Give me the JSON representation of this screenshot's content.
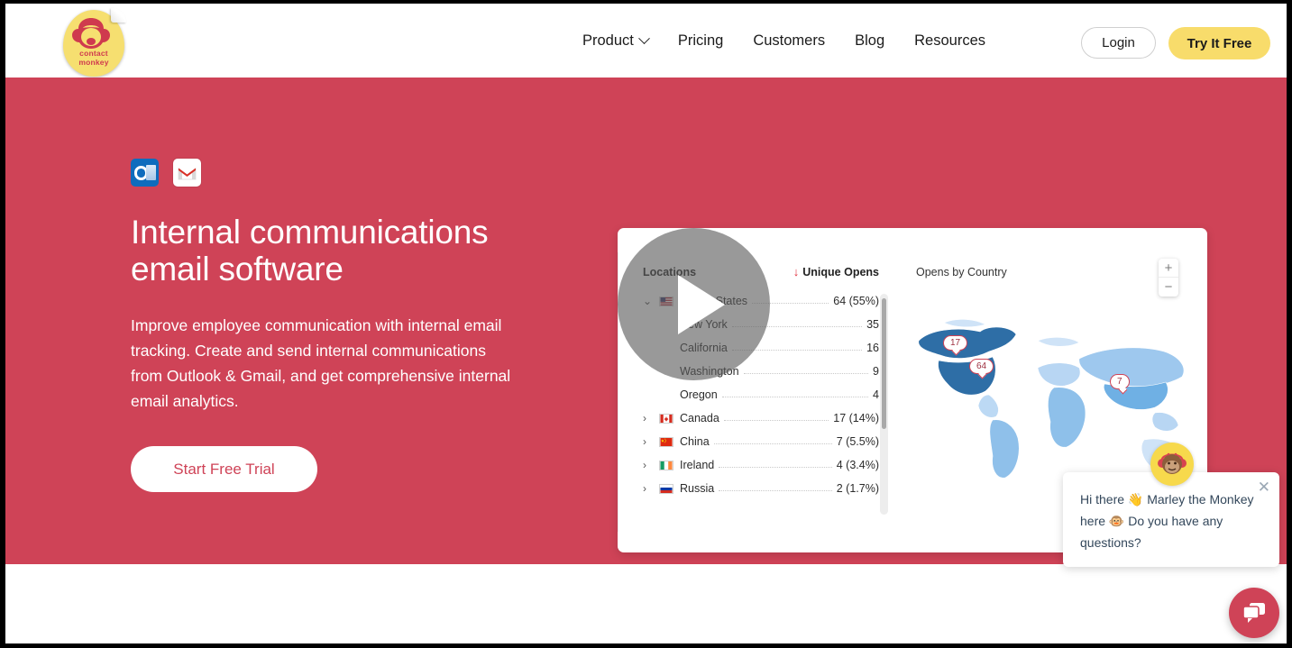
{
  "header": {
    "logo_text_line1": "contact",
    "logo_text_line2": "monkey",
    "nav": [
      {
        "label": "Product",
        "has_dropdown": true
      },
      {
        "label": "Pricing",
        "has_dropdown": false
      },
      {
        "label": "Customers",
        "has_dropdown": false
      },
      {
        "label": "Blog",
        "has_dropdown": false
      },
      {
        "label": "Resources",
        "has_dropdown": false
      }
    ],
    "login_label": "Login",
    "try_label": "Try It Free"
  },
  "hero": {
    "title": "Internal communications email software",
    "body": "Improve employee communication with internal email tracking. Create and send internal communications from Outlook & Gmail, and get comprehensive internal email analytics.",
    "cta_label": "Start Free Trial",
    "background_color": "#cf4357",
    "icons": [
      "outlook-icon",
      "gmail-icon"
    ]
  },
  "product_shot": {
    "locations_header": "Locations",
    "metric_header": "Unique Opens",
    "sort_direction": "descending",
    "rows": [
      {
        "name": "United States",
        "value": "64 (55%)",
        "flag": "us",
        "expanded": true,
        "child": false
      },
      {
        "name": "New York",
        "value": "35",
        "flag": "",
        "expanded": null,
        "child": true
      },
      {
        "name": "California",
        "value": "16",
        "flag": "",
        "expanded": null,
        "child": true
      },
      {
        "name": "Washington",
        "value": "9",
        "flag": "",
        "expanded": null,
        "child": true
      },
      {
        "name": "Oregon",
        "value": "4",
        "flag": "",
        "expanded": null,
        "child": true
      },
      {
        "name": "Canada",
        "value": "17 (14%)",
        "flag": "ca",
        "expanded": false,
        "child": false
      },
      {
        "name": "China",
        "value": "7 (5.5%)",
        "flag": "cn",
        "expanded": false,
        "child": false
      },
      {
        "name": "Ireland",
        "value": "4 (3.4%)",
        "flag": "ie",
        "expanded": false,
        "child": false
      },
      {
        "name": "Russia",
        "value": "2 (1.7%)",
        "flag": "ru",
        "expanded": false,
        "child": false
      }
    ],
    "map_title": "Opens by Country",
    "zoom_in": "+",
    "zoom_out": "−",
    "markers": [
      {
        "label": "17",
        "country": "Canada"
      },
      {
        "label": "64",
        "country": "United States"
      },
      {
        "label": "7",
        "country": "China"
      }
    ],
    "legend_min": "0",
    "legend_max": "50",
    "play_button": "play-icon"
  },
  "chat": {
    "message": "Hi there 👋 Marley the Monkey here 🐵 Do you have any questions?",
    "close_label": "✕",
    "avatar": "monkey-avatar",
    "launcher": "chat-bubble-icon"
  },
  "chart_data": {
    "type": "table",
    "title": "Opens by Country",
    "columns": [
      "Locations",
      "Unique Opens"
    ],
    "categories": [
      "United States",
      "New York",
      "California",
      "Washington",
      "Oregon",
      "Canada",
      "China",
      "Ireland",
      "Russia"
    ],
    "values": [
      64,
      35,
      16,
      9,
      4,
      17,
      7,
      4,
      2
    ],
    "percentages": [
      "55%",
      "",
      "",
      "",
      "",
      "14%",
      "5.5%",
      "3.4%",
      "1.7%"
    ],
    "map_scale": [
      0,
      50
    ],
    "map_markers": {
      "Canada": 17,
      "United States": 64,
      "China": 7
    }
  }
}
